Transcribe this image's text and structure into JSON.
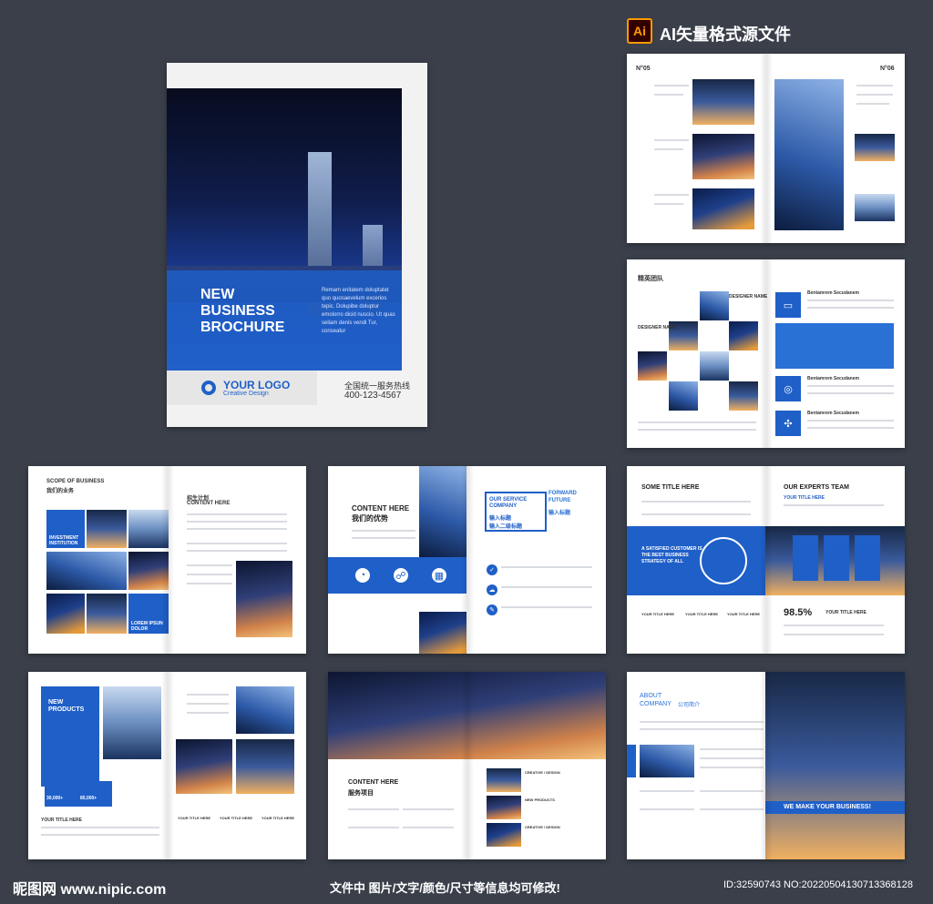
{
  "header": {
    "ai_badge": "Ai",
    "title": "AI矢量格式源文件"
  },
  "cover": {
    "headline_line1": "NEW",
    "headline_line2": "BUSINESS",
    "headline_line3": "BROCHURE",
    "blurb": "Remam enitatem doluptatet quo quosaevelum excerios tepic. Dolupibe doluptur emolorro dicid nuscio. Ut quas seliam denis vendi Tur, conseatur",
    "logo_text": "YOUR LOGO",
    "logo_sub": "Creative Design",
    "hotline_label": "全国统一服务热线",
    "hotline_number": "400-123-4567"
  },
  "spread1": {
    "page_left": "N°05",
    "page_right": "N°06"
  },
  "spread2": {
    "section": "精英团队",
    "designer_label": "DESIGNER NAME",
    "item_title": "Bentamrem Secudanem"
  },
  "spread3": {
    "scope_title": "SCOPE OF BUSINESS",
    "scope_cn": "我们的业务",
    "investment": "INVESTMENT INSTITUTION",
    "lorem": "LOREM IPSUN DOLOR",
    "right_cn": "招生计划",
    "right_en": "CONTENT HERE"
  },
  "spread4": {
    "title_en": "CONTENT HERE",
    "title_cn": "我们的优势",
    "service_en": "OUR SERVICE COMPANY",
    "service_cn1": "输入标题",
    "service_cn2": "输入二级标题",
    "future_en": "FORWARD FUTURE",
    "future_cn": "输入标题"
  },
  "spread5": {
    "left_title": "SOME TITLE HERE",
    "team_title": "OUR EXPERTS TEAM",
    "team_sub": "YOUR TITLE HERE",
    "quote": "A SATISFIED CUSTOMER IS THE BEST BUSINESS STRATEGY OF ALL",
    "percent": "98.5%",
    "your_title": "YOUR TITLE HERE"
  },
  "spread6": {
    "new_products": "NEW PRODUCTS",
    "stat1": "30,000+",
    "stat2": "85,000+",
    "your_title": "YOUR TITLE HERE"
  },
  "spread7": {
    "title_en": "CONTENT HERE",
    "title_cn": "服务项目",
    "caption1": "CREATIVE / DESIGN",
    "caption2": "NEW PRODUCTS"
  },
  "spread8": {
    "about_en": "ABOUT COMPANY",
    "about_cn": "公司简介",
    "slogan": "WE MAKE YOUR BUSINESS!"
  },
  "footer": {
    "site": "昵图网 www.nipic.com",
    "note": "文件中 图片/文字/颜色/尺寸等信息均可修改!",
    "id": "ID:32590743 NO:20220504130713368128"
  }
}
